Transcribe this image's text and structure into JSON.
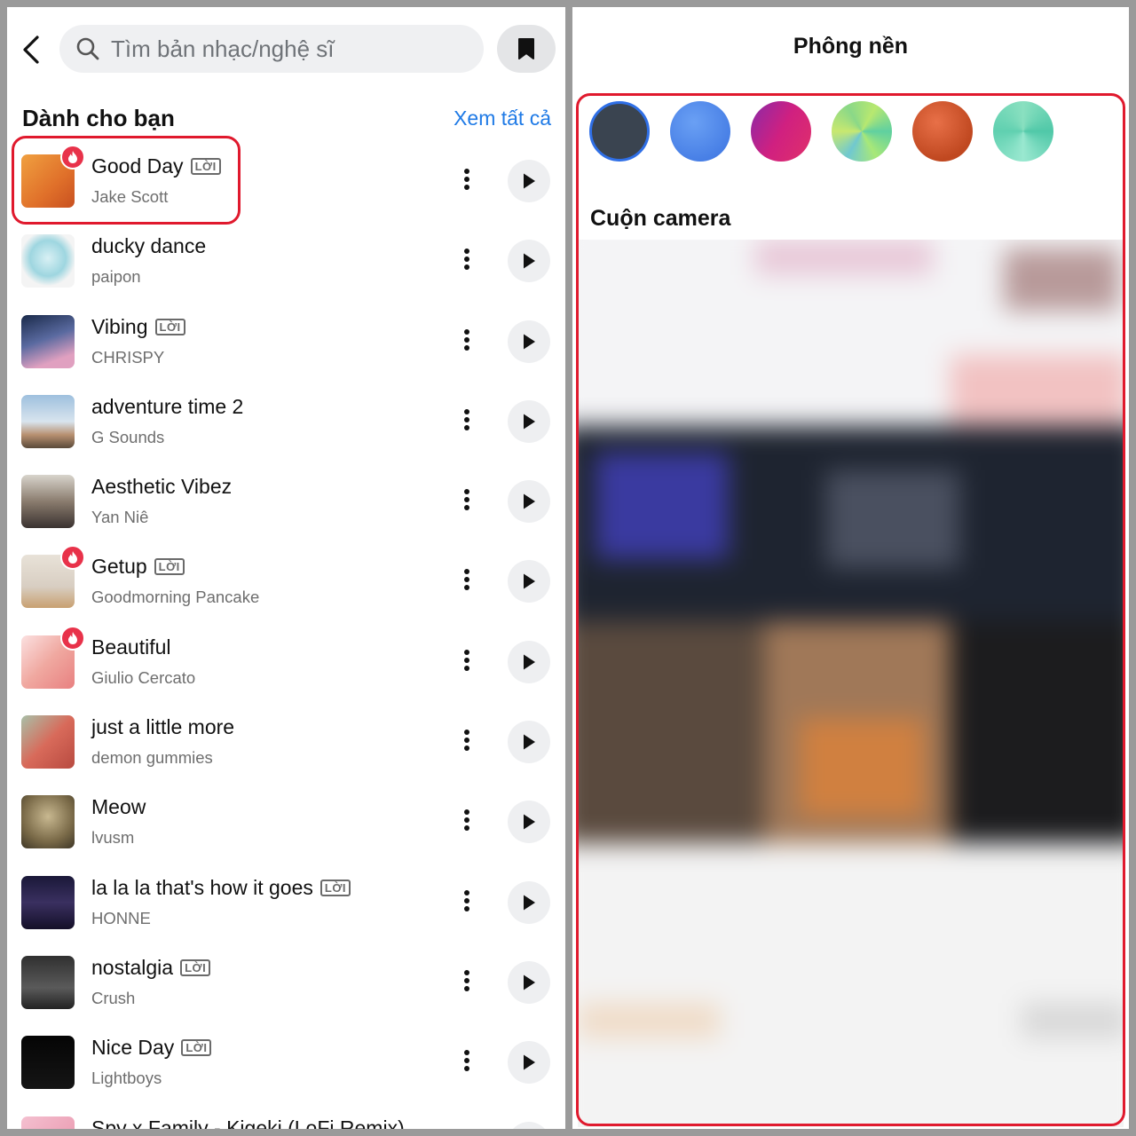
{
  "left": {
    "search": {
      "placeholder": "Tìm bản nhạc/nghệ sĩ"
    },
    "section": {
      "title": "Dành cho bạn",
      "see_all": "Xem tất cả"
    },
    "lyrics_badge": "LỜI",
    "songs": [
      {
        "title": "Good Day",
        "artist": "Jake Scott",
        "lyrics": true,
        "hot": true
      },
      {
        "title": "ducky dance",
        "artist": "paipon",
        "lyrics": false,
        "hot": false
      },
      {
        "title": "Vibing",
        "artist": "CHRISPY",
        "lyrics": true,
        "hot": false
      },
      {
        "title": "adventure time 2",
        "artist": "G Sounds",
        "lyrics": false,
        "hot": false
      },
      {
        "title": "Aesthetic Vibez",
        "artist": "Yan Niê",
        "lyrics": false,
        "hot": false
      },
      {
        "title": "Getup",
        "artist": "Goodmorning Pancake",
        "lyrics": true,
        "hot": true
      },
      {
        "title": "Beautiful",
        "artist": "Giulio Cercato",
        "lyrics": false,
        "hot": true
      },
      {
        "title": "just a little more",
        "artist": "demon gummies",
        "lyrics": false,
        "hot": false
      },
      {
        "title": "Meow",
        "artist": "lvusm",
        "lyrics": false,
        "hot": false
      },
      {
        "title": "la la la that's how it goes",
        "artist": "HONNE",
        "lyrics": true,
        "hot": false
      },
      {
        "title": "nostalgia",
        "artist": "Crush",
        "lyrics": true,
        "hot": false
      },
      {
        "title": "Nice Day",
        "artist": "Lightboys",
        "lyrics": true,
        "hot": false
      },
      {
        "title": "Spy x Family - Kigeki (LoFi Remix)",
        "artist": "",
        "lyrics": false,
        "hot": false
      }
    ]
  },
  "right": {
    "title": "Phông nền",
    "camera_roll_title": "Cuộn camera",
    "background_swatches": [
      {
        "name": "dark-slate",
        "color": "#3a4450",
        "selected": true
      },
      {
        "name": "blue",
        "color": "#4a82ec",
        "selected": false
      },
      {
        "name": "magenta",
        "color": "#c8228a",
        "selected": false
      },
      {
        "name": "green-swirl",
        "color": "#8cd68a",
        "selected": false
      },
      {
        "name": "orange",
        "color": "#d65a30",
        "selected": false
      },
      {
        "name": "teal-swirl",
        "color": "#72d6b6",
        "selected": false
      }
    ]
  },
  "colors": {
    "accent_blue": "#1f7ae6",
    "highlight_red": "#e0192d",
    "hot_badge": "#e8324a"
  }
}
